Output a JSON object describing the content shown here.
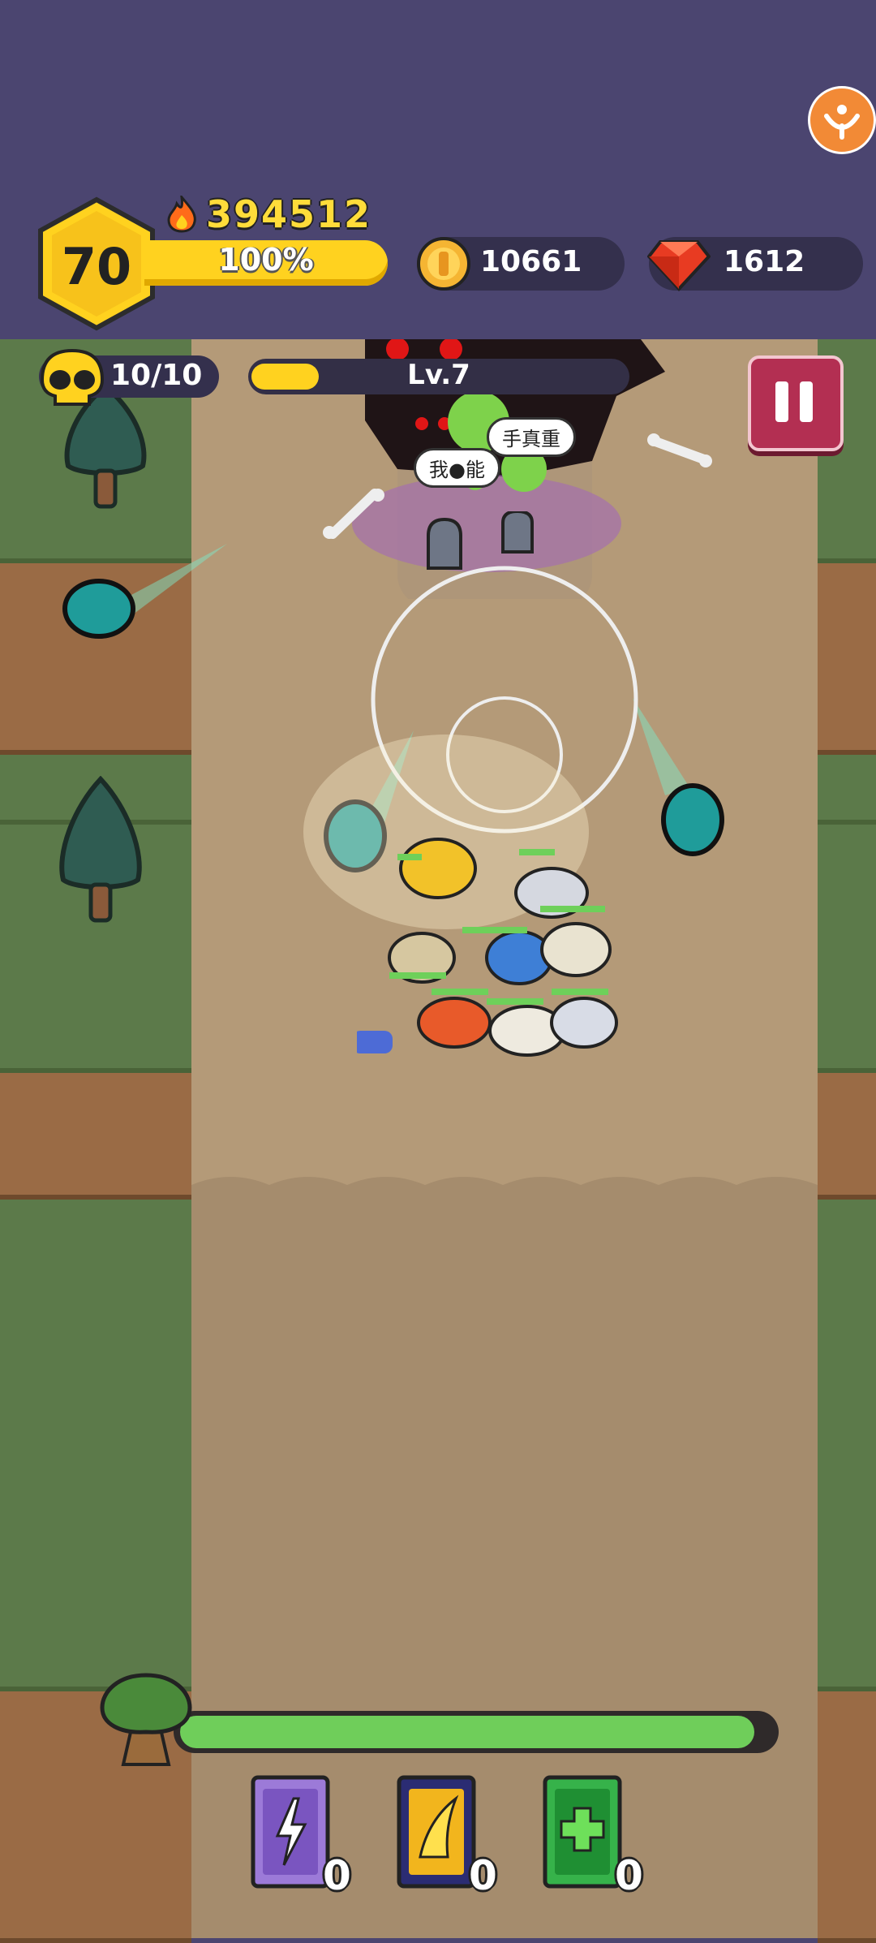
{
  "player": {
    "level": "70",
    "power": "394512",
    "xp_percent": "100%",
    "xp_fraction": 1.0
  },
  "currency": {
    "coins": "10661",
    "gems": "1612"
  },
  "stage": {
    "kills": "10/10",
    "level_label": "Lv.7",
    "level_progress": 0.18
  },
  "boss": {
    "hp_fraction": 0.97
  },
  "skills": [
    {
      "name": "lightning-book",
      "count": "0",
      "color": "#9c7ad8"
    },
    {
      "name": "wing-book",
      "count": "0",
      "color": "#f2b51d"
    },
    {
      "name": "heal-book",
      "count": "0",
      "color": "#36b24a"
    }
  ],
  "speech": {
    "bubble1": "我●能",
    "bubble2": "手真重"
  },
  "colors": {
    "hud_bg": "#4b4570",
    "accent_yellow": "#ffd21f",
    "pause_red": "#b32f52",
    "hp_green": "#6fce5a"
  },
  "icons": [
    "flame-icon",
    "coin-icon",
    "gem-icon",
    "skull-icon",
    "pause-icon",
    "settings-icon",
    "tree-boss-icon"
  ]
}
